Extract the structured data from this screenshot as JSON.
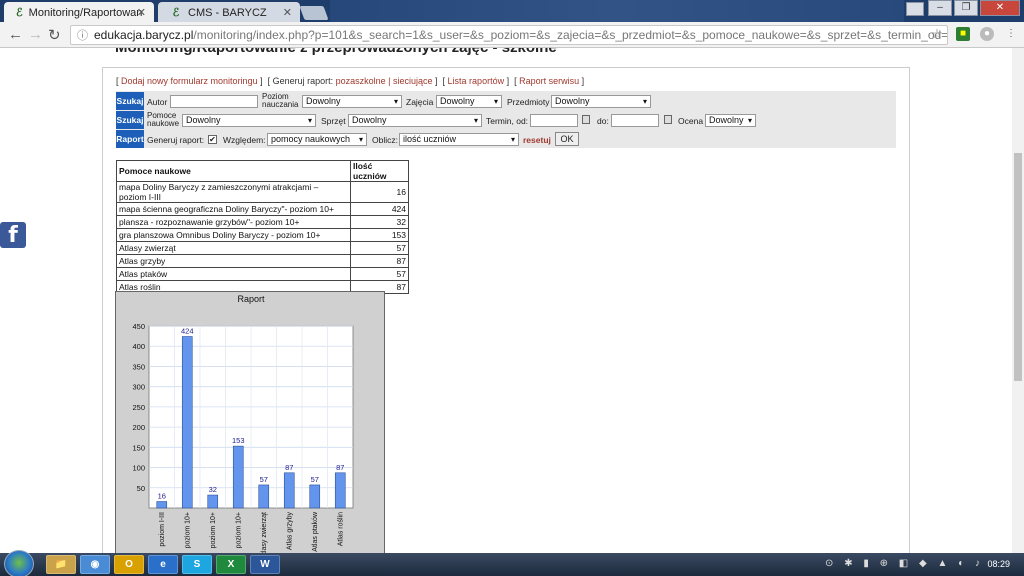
{
  "browser": {
    "tabs": [
      {
        "label": "Monitoring/Raportowan",
        "active": true
      },
      {
        "label": "CMS - BARYCZ",
        "active": false
      }
    ],
    "url_host": "edukacja.barycz.pl",
    "url_path": "/monitoring/index.php?p=101&s_search=1&s_user=&s_poziom=&s_zajecia=&s_przedmiot=&s_pomoce_naukowe=&s_sprzet=&s_termin_od=&s_termin_do=&"
  },
  "page": {
    "heading": "Monitoring/Raportowanie z przeprowadzonych zajęć - szkolne",
    "links": {
      "add_form": "Dodaj nowy formularz monitoringu",
      "generate_prefix": "Generuj raport:",
      "generate_options": "pozaszkolne | sieciujące",
      "report_list": "Lista raportów",
      "service_report": "Raport serwisu"
    },
    "filters": {
      "row1_tag": "Szukaj",
      "author_label": "Autor",
      "level_label": "Poziom nauczania",
      "level_value": "Dowolny",
      "classes_label": "Zajęcia",
      "classes_value": "Dowolny",
      "subjects_label": "Przedmioty",
      "subjects_value": "Dowolny",
      "row2_tag": "Szukaj",
      "aids_label": "Pomoce naukowe",
      "aids_value": "Dowolny",
      "equipment_label": "Sprzęt",
      "equipment_value": "Dowolny",
      "date_from_label": "Termin, od:",
      "date_to_label": "do:",
      "rating_label": "Ocena",
      "rating_value": "Dowolny",
      "row3_tag": "Raport",
      "generate_label": "Generuj raport:",
      "generate_checked": "✔",
      "relative_label": "Względem:",
      "relative_value": "pomocy naukowych",
      "calc_label": "Oblicz:",
      "calc_value": "ilość uczniów",
      "reset_label": "resetuj",
      "ok_label": "OK"
    },
    "table": {
      "headers": [
        "Pomoce naukowe",
        "Ilość uczniów"
      ],
      "rows": [
        [
          "mapa Doliny Baryczy z zamieszczonymi atrakcjami – poziom I-III",
          "16"
        ],
        [
          "mapa ścienna geograficzna Doliny Baryczy\"- poziom 10+",
          "424"
        ],
        [
          "plansza - rozpoznawanie grzybów\"- poziom 10+",
          "32"
        ],
        [
          "gra planszowa Omnibus Doliny Baryczy - poziom 10+",
          "153"
        ],
        [
          "Atlasy zwierząt",
          "57"
        ],
        [
          "Atlas grzyby",
          "87"
        ],
        [
          "Atlas ptaków",
          "57"
        ],
        [
          "Atlas roślin",
          "87"
        ]
      ]
    },
    "facebook_glyph": "f"
  },
  "chart_data": {
    "type": "bar",
    "title": "Raport",
    "categories": [
      "poziom I-III",
      "poziom 10+",
      "poziom 10+",
      "poziom 10+",
      "Atlasy zwierząt",
      "Atlas grzyby",
      "Atlas ptaków",
      "Atlas roślin"
    ],
    "values": [
      16,
      424,
      32,
      153,
      57,
      87,
      57,
      87
    ],
    "yticks": [
      50,
      100,
      150,
      200,
      250,
      300,
      350,
      400,
      450
    ],
    "ylim": [
      0,
      450
    ],
    "grid": true,
    "bar_color": "#6495ed",
    "label_color": "#1a1a8c"
  },
  "taskbar": {
    "apps": [
      "📁",
      "◉",
      "O",
      "e",
      "S",
      "X",
      "W"
    ],
    "clock": "08:29"
  }
}
